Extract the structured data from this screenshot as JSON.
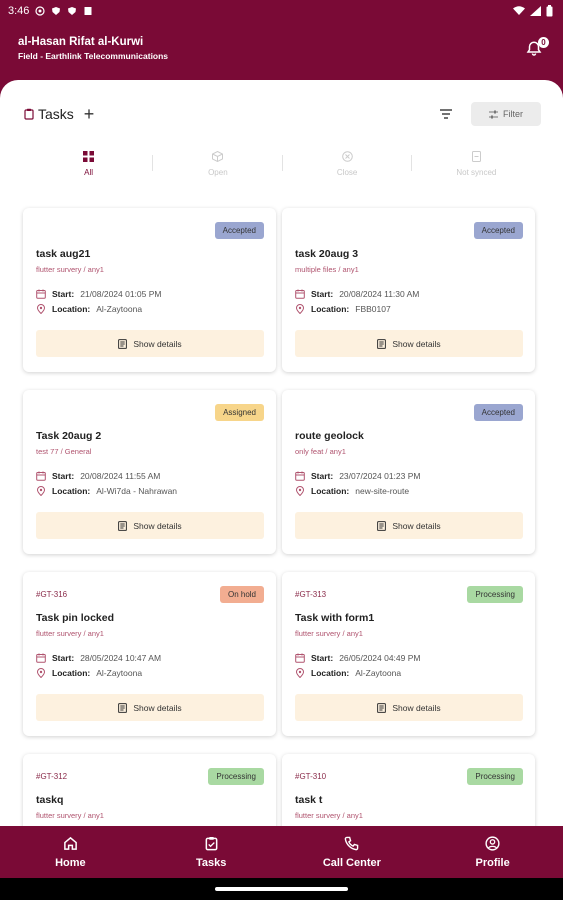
{
  "statusbar": {
    "time": "3:46"
  },
  "header": {
    "user_name": "al-Hasan Rifat al-Kurwi",
    "subtitle": "Field - Earthlink Telecommunications",
    "notification_count": "0"
  },
  "page": {
    "title": "Tasks",
    "filter_label": "Filter"
  },
  "tabs": [
    {
      "label": "All"
    },
    {
      "label": "Open"
    },
    {
      "label": "Close"
    },
    {
      "label": "Not synced"
    }
  ],
  "labels": {
    "start": "Start:",
    "location": "Location:",
    "show_details": "Show details"
  },
  "colors": {
    "brand": "#7a0a36",
    "accepted": "#9aa6d0",
    "assigned": "#f7d58a",
    "on_hold": "#f2ad91",
    "processing": "#a9d9a2"
  },
  "tasks": [
    {
      "code": "",
      "status": "Accepted",
      "name": "task aug21",
      "category": "flutter survery / any1",
      "start": "21/08/2024 01:05 PM",
      "location": "Al-Zaytoona"
    },
    {
      "code": "",
      "status": "Accepted",
      "name": "task 20aug 3",
      "category": "multiple files / any1",
      "start": "20/08/2024 11:30 AM",
      "location": "FBB0107"
    },
    {
      "code": "",
      "status": "Assigned",
      "name": "Task 20aug 2",
      "category": "test 77 / General",
      "start": "20/08/2024 11:55 AM",
      "location": "Al-Wi7da - Nahrawan"
    },
    {
      "code": "",
      "status": "Accepted",
      "name": "route geolock",
      "category": "only feat / any1",
      "start": "23/07/2024 01:23 PM",
      "location": "new-site-route"
    },
    {
      "code": "#GT-316",
      "status": "On hold",
      "name": "Task pin locked",
      "category": "flutter survery / any1",
      "start": "28/05/2024 10:47 AM",
      "location": "Al-Zaytoona"
    },
    {
      "code": "#GT-313",
      "status": "Processing",
      "name": "Task with form1",
      "category": "flutter survery / any1",
      "start": "26/05/2024 04:49 PM",
      "location": "Al-Zaytoona"
    },
    {
      "code": "#GT-312",
      "status": "Processing",
      "name": "taskq",
      "category": "flutter survery / any1"
    },
    {
      "code": "#GT-310",
      "status": "Processing",
      "name": "task t",
      "category": "flutter survery / any1"
    }
  ],
  "bottom_nav": [
    {
      "label": "Home",
      "icon": "home-icon"
    },
    {
      "label": "Tasks",
      "icon": "clipboard-icon"
    },
    {
      "label": "Call Center",
      "icon": "phone-icon"
    },
    {
      "label": "Profile",
      "icon": "profile-icon"
    }
  ]
}
